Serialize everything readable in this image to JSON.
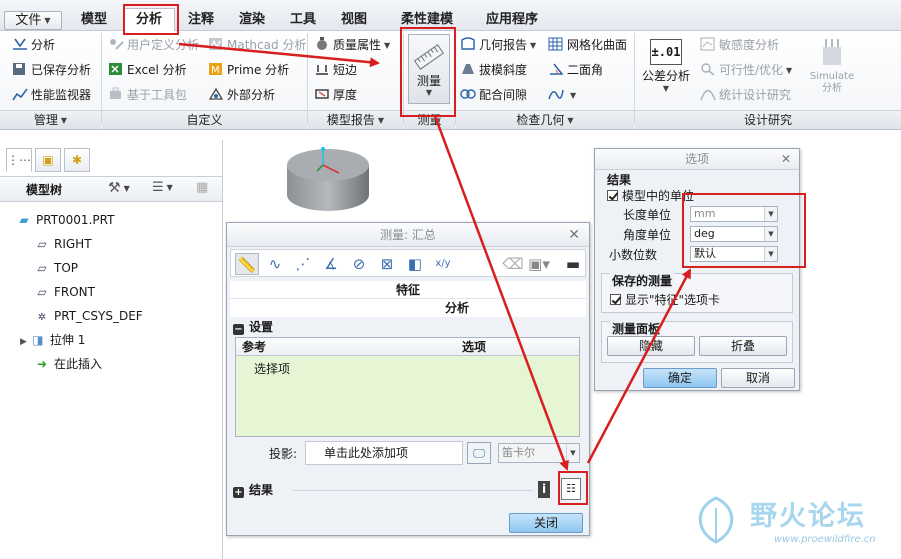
{
  "menu": {
    "file": "文件",
    "tabs": [
      "模型",
      "分析",
      "注释",
      "渲染",
      "工具",
      "视图",
      "柔性建模",
      "应用程序"
    ],
    "active_index": 1
  },
  "ribbon": {
    "manage": {
      "items": [
        "分析",
        "已保存分析",
        "性能监视器"
      ],
      "group": "管理"
    },
    "custom": {
      "items": [
        "用户定义分析",
        "Mathcad 分析",
        "Excel 分析",
        "Prime 分析",
        "基于工具包",
        "外部分析"
      ],
      "group": "自定义"
    },
    "model_report": {
      "items": [
        "质量属性",
        "短边",
        "厚度"
      ],
      "group": "模型报告"
    },
    "measure": {
      "label": "测量",
      "group": "测量"
    },
    "inspect": {
      "items": [
        "几何报告",
        "网格化曲面",
        "拔模斜度",
        "二面角",
        "配合间隙"
      ],
      "group": "检查几何"
    },
    "design": {
      "items": [
        "公差分析",
        "敏感度分析",
        "可行性/优化",
        "统计设计研究"
      ],
      "simulate": [
        "Simulate",
        "分析"
      ],
      "group": "设计研究"
    }
  },
  "left_panel": {
    "tree_title": "模型树",
    "items": [
      "PRT0001.PRT",
      "RIGHT",
      "TOP",
      "FRONT",
      "PRT_CSYS_DEF",
      "拉伸 1",
      "在此插入"
    ]
  },
  "measure_dialog": {
    "title": "测量: 汇总",
    "feature_label": "特征",
    "analysis_label": "分析",
    "settings_label": "设置",
    "col_ref": "参考",
    "col_option": "选项",
    "ref_item": "选择项",
    "projection_label": "投影:",
    "projection_placeholder": "单击此处添加项",
    "coord_value": "笛卡尔",
    "result_label": "结果",
    "close": "关闭"
  },
  "options_dialog": {
    "title": "选项",
    "result_label": "结果",
    "model_units": "模型中的单位",
    "length_unit_label": "长度单位",
    "length_unit_value": "mm",
    "angle_unit_label": "角度单位",
    "angle_unit_value": "deg",
    "decimal_label": "小数位数",
    "decimal_value": "默认",
    "saved_label": "保存的测量",
    "show_feature_tab": "显示\"特征\"选项卡",
    "panel_label": "测量面板",
    "hide": "隐藏",
    "collapse": "折叠",
    "ok": "确定",
    "cancel": "取消"
  },
  "watermark": {
    "title": "野火论坛",
    "url": "www.proewildfire.cn"
  },
  "colors": {
    "highlight": "#d81e1e",
    "ref_bg": "#e6f5d4",
    "accent": "#3a6fb0"
  }
}
